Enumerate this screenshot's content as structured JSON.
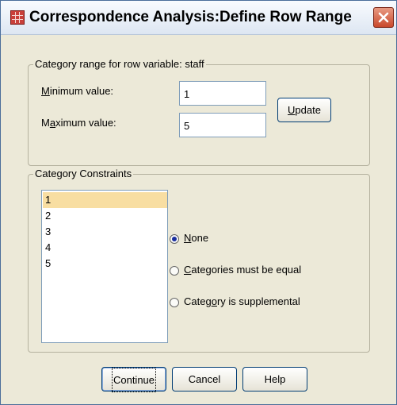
{
  "window": {
    "title": "Correspondence Analysis:Define Row Range",
    "close_glyph": "✕"
  },
  "range_group": {
    "title": "Category range for row variable:  staff",
    "min_label_prefix": "",
    "min_label_accel": "M",
    "min_label_rest": "inimum value:",
    "min_value": "1",
    "max_label_prefix": "M",
    "max_label_accel": "a",
    "max_label_rest": "ximum value:",
    "max_value": "5",
    "update_accel": "U",
    "update_rest": "pdate"
  },
  "constraints_group": {
    "title": "Category Constraints",
    "categories": [
      "1",
      "2",
      "3",
      "4",
      "5"
    ],
    "selected_index": 0,
    "radios": [
      {
        "prefix": "",
        "accel": "N",
        "rest": "one",
        "checked": true
      },
      {
        "prefix": "",
        "accel": "C",
        "rest": "ategories must be equal",
        "checked": false
      },
      {
        "prefix": "Categ",
        "accel": "o",
        "rest": "ry is supplemental",
        "checked": false
      }
    ]
  },
  "buttons": {
    "continue": "Continue",
    "cancel": "Cancel",
    "help": "Help"
  },
  "colors": {
    "dialog_bg": "#ece9d8",
    "selection": "#f8dea2",
    "close_button": "#c9482c"
  }
}
